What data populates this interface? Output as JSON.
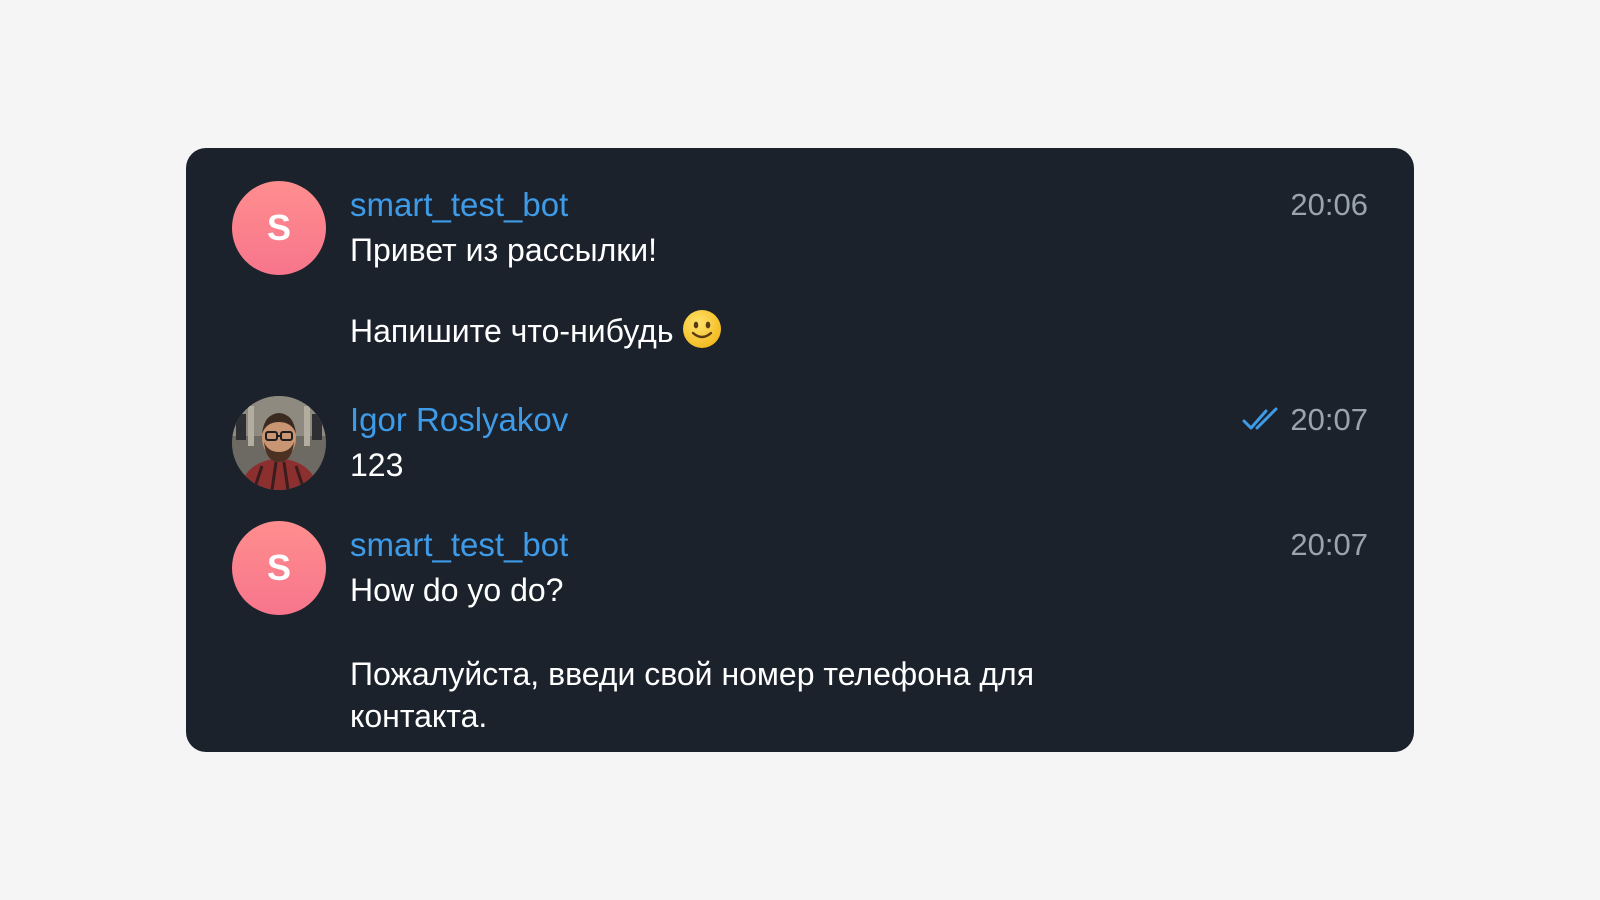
{
  "messages": [
    {
      "sender": "smart_test_bot",
      "avatar_letter": "S",
      "time": "20:06",
      "text": "Привет из рассылки!",
      "text_second": "Напишите что-нибудь",
      "emoji": "slightly-smiling-face-icon"
    },
    {
      "sender": "Igor Roslyakov",
      "time": "20:07",
      "status_icon": "double-check-icon",
      "text": "123"
    },
    {
      "sender": "smart_test_bot",
      "avatar_letter": "S",
      "time": "20:07",
      "text": "How do yo do?",
      "text_second": "Пожалуйста, введи свой номер телефона для",
      "text_third": "контакта."
    }
  ],
  "colors": {
    "page_background": "#f5f5f5",
    "panel_background": "#1b222c",
    "sender_name": "#3e9be8",
    "timestamp": "#9aa4af",
    "message_text": "#ffffff",
    "bot_avatar_top": "#ff8e8e",
    "bot_avatar_bottom": "#f7758c",
    "read_check": "#3e9be8"
  }
}
